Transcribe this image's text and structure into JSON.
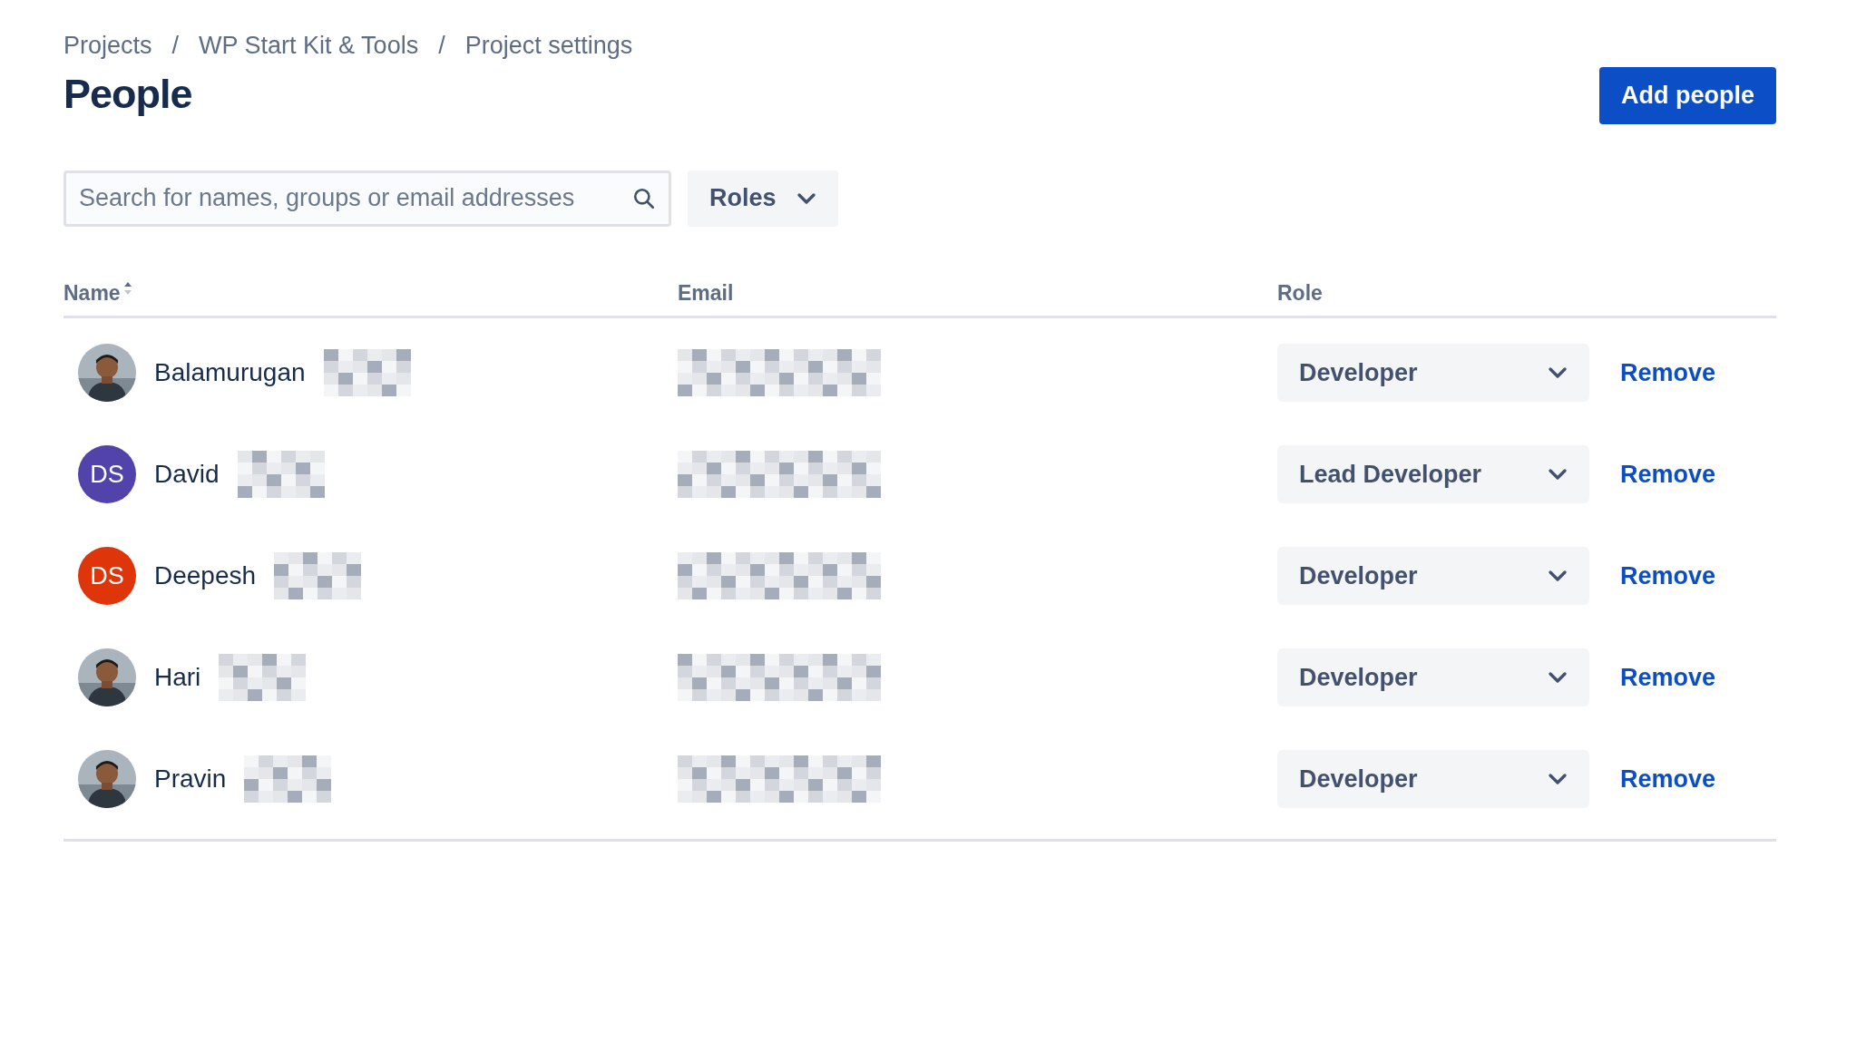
{
  "breadcrumbs": [
    "Projects",
    "WP Start Kit & Tools",
    "Project settings"
  ],
  "breadcrumb_separator": "/",
  "title": "People",
  "add_button": "Add people",
  "search": {
    "placeholder": "Search for names, groups or email addresses"
  },
  "roles_filter": "Roles",
  "table": {
    "columns": [
      {
        "label": "Name",
        "sorted": true
      },
      {
        "label": "Email",
        "sorted": false
      },
      {
        "label": "Role",
        "sorted": false
      }
    ],
    "rows": [
      {
        "name": "Balamurugan",
        "role": "Developer",
        "action": "Remove"
      },
      {
        "name": "David",
        "avatar": {
          "kind": "initials",
          "initials": "DS",
          "color": "#5243aa"
        },
        "role": "Lead Developer",
        "action": "Remove"
      },
      {
        "name": "Deepesh",
        "avatar": {
          "kind": "initials",
          "initials": "DS",
          "color": "#de350b"
        },
        "role": "Developer",
        "action": "Remove"
      },
      {
        "name": "Hari",
        "role": "Developer",
        "action": "Remove"
      },
      {
        "name": "Pravin",
        "role": "Developer",
        "action": "Remove"
      }
    ]
  }
}
